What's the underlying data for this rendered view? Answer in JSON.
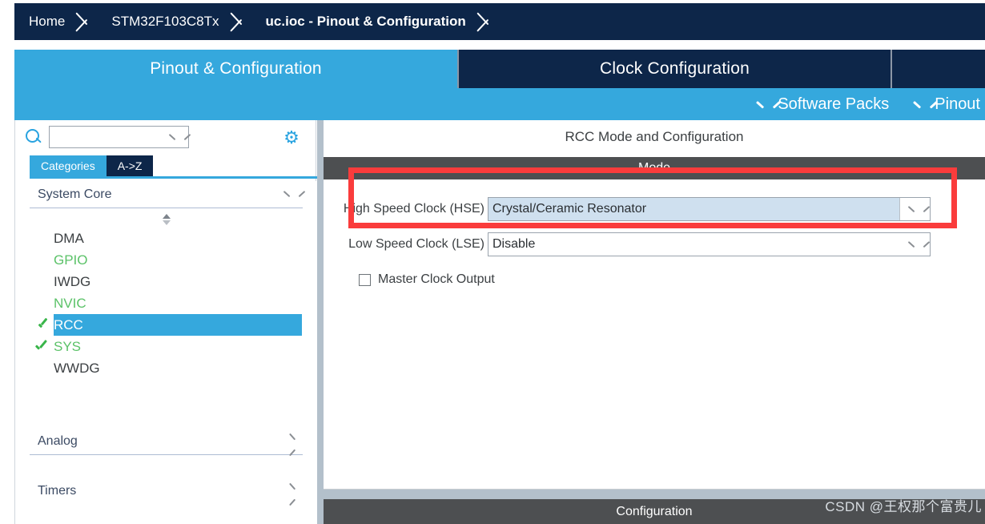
{
  "breadcrumb": {
    "items": [
      {
        "label": "Home",
        "active": false
      },
      {
        "label": "STM32F103C8Tx",
        "active": false
      },
      {
        "label": "uc.ioc - Pinout & Configuration",
        "active": true
      }
    ]
  },
  "tabs": [
    {
      "label": "Pinout & Configuration",
      "selected": true
    },
    {
      "label": "Clock Configuration",
      "selected": false
    },
    {
      "label": "",
      "selected": false
    }
  ],
  "menustrip": {
    "items": [
      {
        "label": "Software Packs",
        "icon": "chevron-down-icon"
      },
      {
        "label": "Pinout",
        "icon": "chevron-down-icon"
      }
    ]
  },
  "sidebar": {
    "search": {
      "value": "",
      "placeholder": "",
      "icon": "search-icon"
    },
    "settings_icon": "gear-icon",
    "view_tabs": [
      {
        "label": "Categories",
        "selected": true
      },
      {
        "label": "A->Z",
        "selected": false
      }
    ],
    "groups": [
      {
        "label": "System Core",
        "expanded": true,
        "chevron": "chevron-down-icon",
        "items": [
          {
            "label": "DMA",
            "state": "plain",
            "icon": "none"
          },
          {
            "label": "GPIO",
            "state": "green",
            "icon": "none"
          },
          {
            "label": "IWDG",
            "state": "plain",
            "icon": "none"
          },
          {
            "label": "NVIC",
            "state": "green",
            "icon": "none"
          },
          {
            "label": "RCC",
            "state": "selected",
            "icon": "check-circle-icon"
          },
          {
            "label": "SYS",
            "state": "green",
            "icon": "check-icon"
          },
          {
            "label": "WWDG",
            "state": "plain",
            "icon": "none"
          }
        ]
      },
      {
        "label": "Analog",
        "expanded": false,
        "chevron": "chevron-right-icon",
        "items": []
      },
      {
        "label": "Timers",
        "expanded": false,
        "chevron": "chevron-right-icon",
        "items": []
      }
    ]
  },
  "main": {
    "title": "RCC Mode and Configuration",
    "mode_section": {
      "header": "Mode",
      "fields": [
        {
          "label": "High Speed Clock (HSE)",
          "value": "Crystal/Ceramic Resonator",
          "highlighted": true,
          "chevron": "chevron-down-icon"
        },
        {
          "label": "Low Speed Clock (LSE)",
          "value": "Disable",
          "highlighted": false,
          "chevron": "chevron-down-icon"
        }
      ],
      "checkbox": {
        "label": "Master Clock Output",
        "checked": false
      }
    },
    "config_section": {
      "header": "Configuration"
    }
  },
  "annotation": {
    "type": "rectangle",
    "color": "#fa3c3c",
    "target": "High Speed Clock (HSE)"
  },
  "watermark": {
    "text": "CSDN @王权那个富贵儿"
  },
  "colors": {
    "navy": "#0d2649",
    "accent_blue": "#35a8dd",
    "dark_gray_header": "#4d4f51",
    "green_text": "#5bc268",
    "highlight_field": "#cfe0ef",
    "annotation_red": "#fa3c3c",
    "splitter": "#b3c0cb"
  }
}
